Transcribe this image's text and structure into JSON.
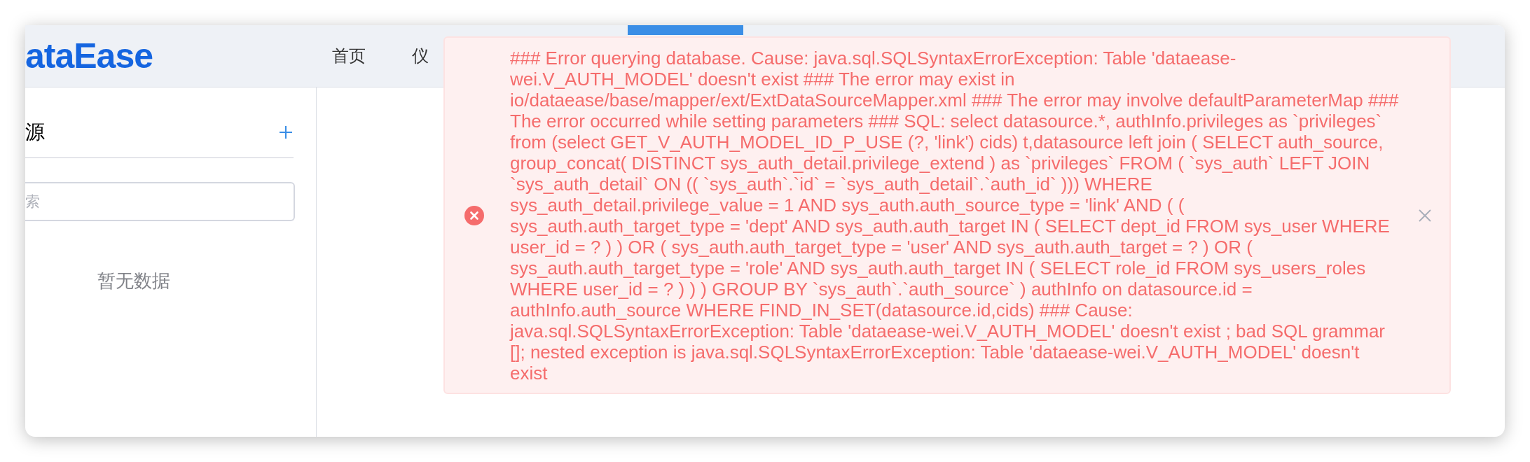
{
  "header": {
    "logo": "ataEase",
    "nav": [
      {
        "label": "首页"
      },
      {
        "label": "仪"
      }
    ]
  },
  "sidebar": {
    "title": "源",
    "search": {
      "placeholder": "索"
    },
    "empty_text": "暂无数据"
  },
  "message": {
    "kind": "error",
    "text": "### Error querying database. Cause: java.sql.SQLSyntaxErrorException: Table 'dataease-wei.V_AUTH_MODEL' doesn't exist ### The error may exist in io/dataease/base/mapper/ext/ExtDataSourceMapper.xml ### The error may involve defaultParameterMap ### The error occurred while setting parameters ### SQL: select datasource.*, authInfo.privileges as `privileges` from (select GET_V_AUTH_MODEL_ID_P_USE (?, 'link') cids) t,datasource left join ( SELECT auth_source, group_concat( DISTINCT sys_auth_detail.privilege_extend ) as `privileges` FROM ( `sys_auth` LEFT JOIN `sys_auth_detail` ON (( `sys_auth`.`id` = `sys_auth_detail`.`auth_id` ))) WHERE sys_auth_detail.privilege_value = 1 AND sys_auth.auth_source_type = 'link' AND ( ( sys_auth.auth_target_type = 'dept' AND sys_auth.auth_target IN ( SELECT dept_id FROM sys_user WHERE user_id = ? ) ) OR ( sys_auth.auth_target_type = 'user' AND sys_auth.auth_target = ? ) OR ( sys_auth.auth_target_type = 'role' AND sys_auth.auth_target IN ( SELECT role_id FROM sys_users_roles WHERE user_id = ? ) ) ) GROUP BY `sys_auth`.`auth_source` ) authInfo on datasource.id = authInfo.auth_source WHERE FIND_IN_SET(datasource.id,cids) ### Cause: java.sql.SQLSyntaxErrorException: Table 'dataease-wei.V_AUTH_MODEL' doesn't exist ; bad SQL grammar []; nested exception is java.sql.SQLSyntaxErrorException: Table 'dataease-wei.V_AUTH_MODEL' doesn't exist"
  }
}
